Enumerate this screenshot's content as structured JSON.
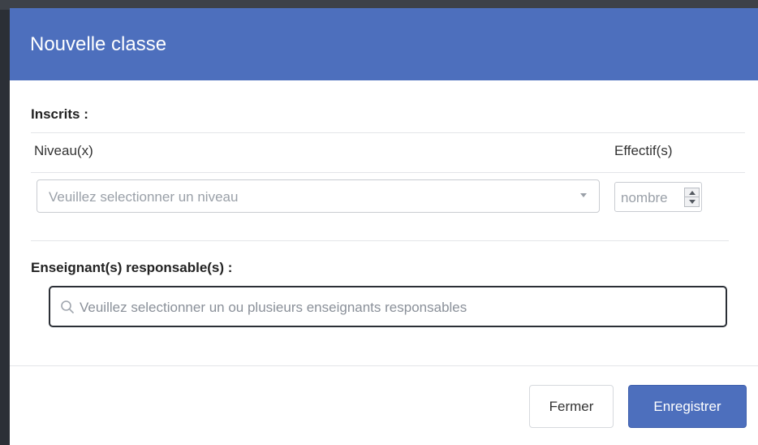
{
  "modal": {
    "title": "Nouvelle classe"
  },
  "inscrits": {
    "label": "Inscrits :",
    "columns": {
      "niveau": "Niveau(x)",
      "effectif": "Effectif(s)"
    },
    "niveau_select": {
      "placeholder": "Veuillez selectionner un niveau"
    },
    "effectif_input": {
      "placeholder": "nombre"
    }
  },
  "teachers": {
    "label": "Enseignant(s) responsable(s) :",
    "search": {
      "placeholder": "Veuillez selectionner un ou plusieurs enseignants responsables",
      "icon": "search-icon"
    }
  },
  "footer": {
    "close_label": "Fermer",
    "save_label": "Enregistrer"
  },
  "colors": {
    "header": "#4d6fbd",
    "primary_button": "#4d6fbd"
  }
}
